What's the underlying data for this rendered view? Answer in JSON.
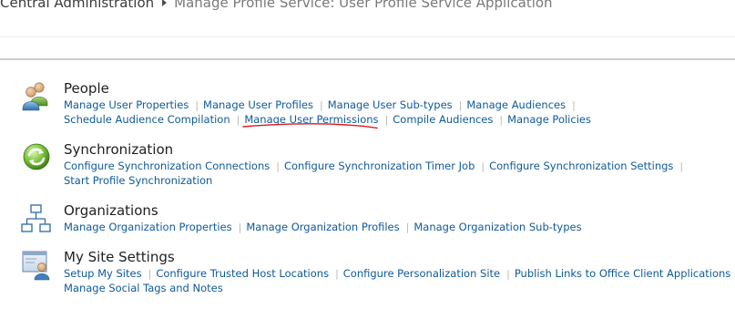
{
  "breadcrumb": {
    "root": "Central Administration",
    "current": "Manage Profile Service: User Profile Service Application"
  },
  "sections": {
    "people": {
      "title": "People",
      "icon": "people-icon",
      "links": [
        "Manage User Properties",
        "Manage User Profiles",
        "Manage User Sub-types",
        "Manage Audiences",
        "Schedule Audience Compilation",
        "Manage User Permissions",
        "Compile Audiences",
        "Manage Policies"
      ]
    },
    "sync": {
      "title": "Synchronization",
      "icon": "sync-icon",
      "links": [
        "Configure Synchronization Connections",
        "Configure Synchronization Timer Job",
        "Configure Synchronization Settings",
        "Start Profile Synchronization"
      ]
    },
    "orgs": {
      "title": "Organizations",
      "icon": "org-chart-icon",
      "links": [
        "Manage Organization Properties",
        "Manage Organization Profiles",
        "Manage Organization Sub-types"
      ]
    },
    "mysite": {
      "title": "My Site Settings",
      "icon": "my-site-icon",
      "links": [
        "Setup My Sites",
        "Configure Trusted Host Locations",
        "Configure Personalization Site",
        "Publish Links to Office Client Applications",
        "Manage Social Tags and Notes"
      ]
    }
  },
  "separator": "|",
  "colors": {
    "link": "#0f5a99",
    "title": "#1f1f1f",
    "annotation": "#e0191f"
  },
  "annotation": {
    "icon": "red-underline-mark"
  }
}
